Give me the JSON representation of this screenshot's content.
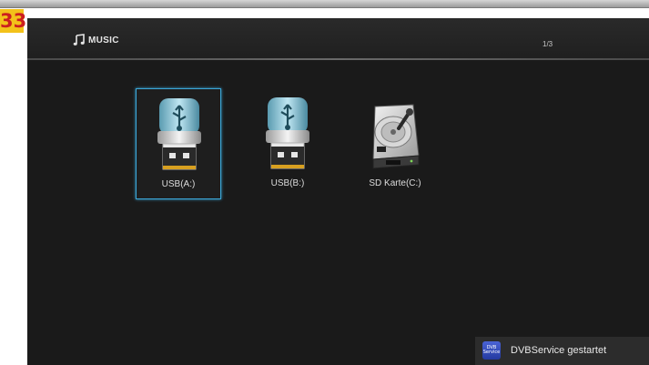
{
  "step_badge": "33",
  "header": {
    "section_icon": "music-note-icon",
    "section_title": "MUSIC",
    "page_indicator": "1/3"
  },
  "devices": [
    {
      "label": "USB(A:)",
      "icon": "usb-drive-icon",
      "selected": true
    },
    {
      "label": "USB(B:)",
      "icon": "usb-drive-icon",
      "selected": false
    },
    {
      "label": "SD Karte(C:)",
      "icon": "hard-drive-icon",
      "selected": false
    }
  ],
  "notification": {
    "icon_text_line1": "DVB",
    "icon_text_line2": "Service",
    "message": "DVBService gestartet"
  },
  "colors": {
    "background": "#1b1b1b",
    "selection_border": "#3ba7d8",
    "badge_bg": "#f3c21a",
    "badge_text": "#cc1f1f"
  }
}
